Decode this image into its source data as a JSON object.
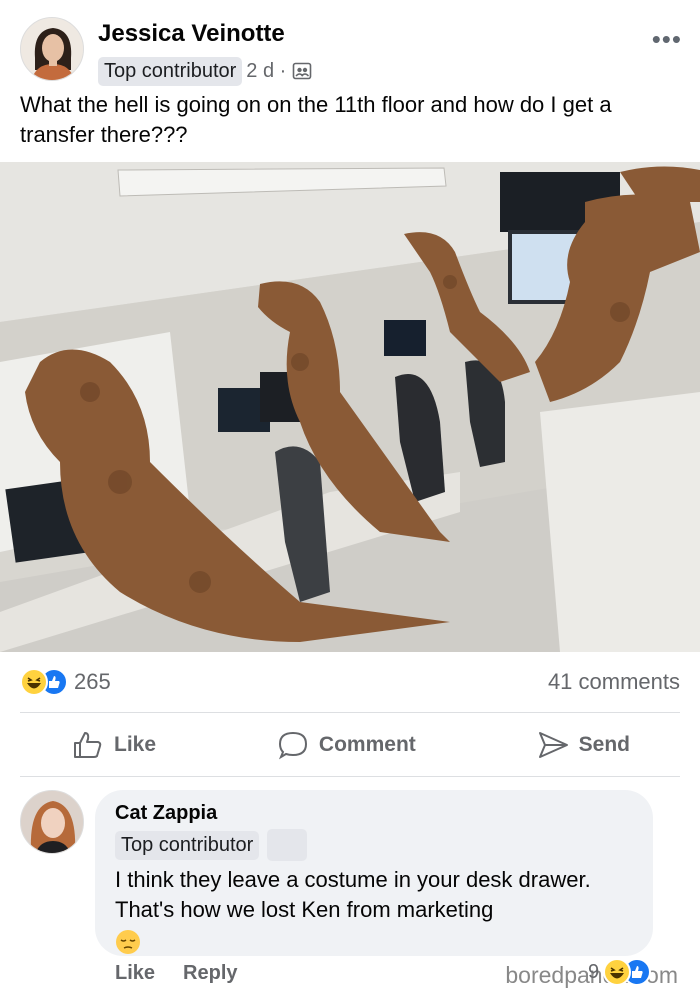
{
  "post": {
    "author": "Jessica Veinotte",
    "badge": "Top contributor",
    "time": "2 d ·",
    "text": "What the hell is going on on the 11th floor and how do I get a transfer there???"
  },
  "stats": {
    "reaction_count": "265",
    "comments": "41 comments"
  },
  "actions": {
    "like": "Like",
    "comment": "Comment",
    "send": "Send"
  },
  "comment": {
    "author": "Cat Zappia",
    "badge": "Top contributor",
    "text": "I think they leave a costume in your desk drawer. That's how we lost Ken from marketing",
    "like": "Like",
    "reply": "Reply",
    "reaction_count": "9"
  },
  "watermark": "boredpanda.com",
  "colors": {
    "accent": "#1877f2",
    "haha": "#ffd23f",
    "muted": "#65676b",
    "bubble": "#f0f2f5"
  },
  "icons": [
    "more-icon",
    "audience-icon",
    "haha-icon",
    "like-icon",
    "thumbs-up-icon",
    "comment-icon",
    "send-icon",
    "pensive-emoji-icon"
  ]
}
